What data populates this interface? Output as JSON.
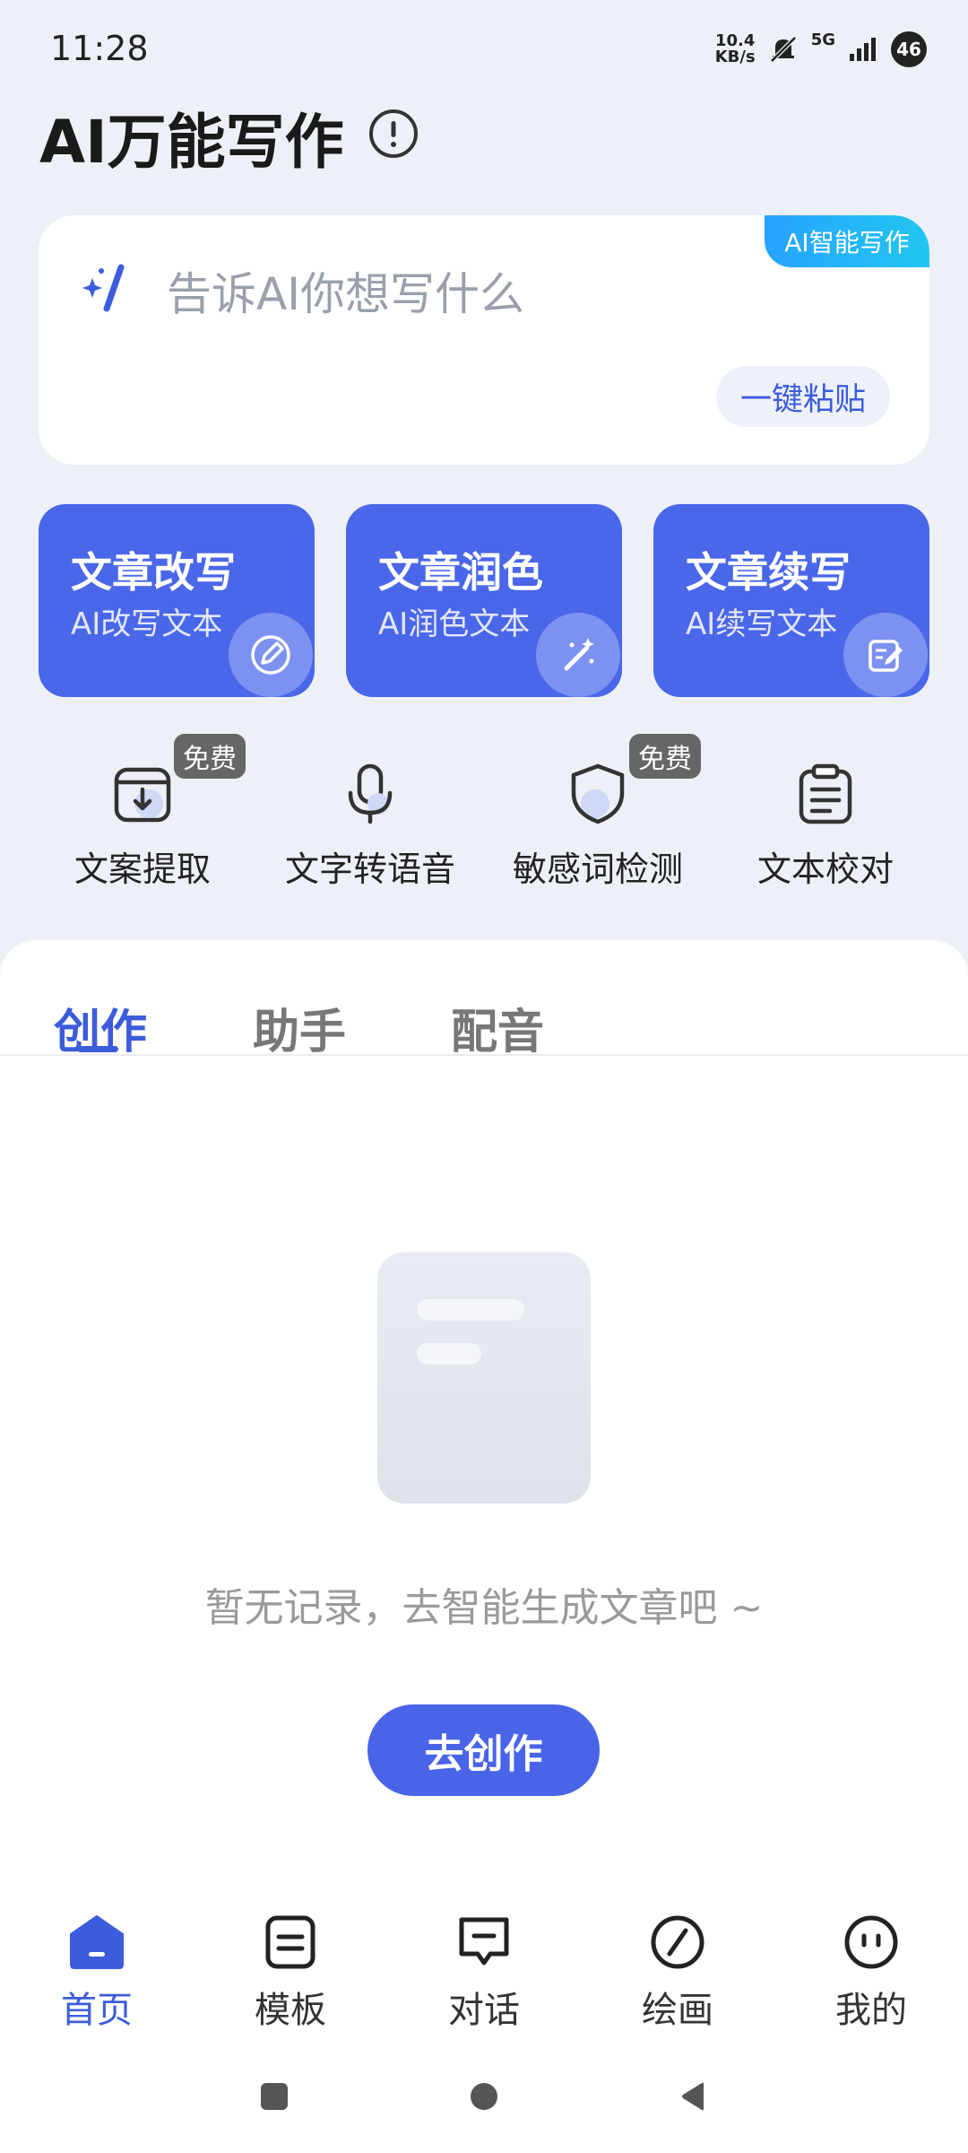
{
  "status_bar": {
    "time": "11:28",
    "net_speed_value": "10.4",
    "net_speed_unit": "KB/s",
    "network": "5G",
    "battery": "46"
  },
  "header": {
    "title": "AI万能写作"
  },
  "input_card": {
    "tag": "AI智能写作",
    "placeholder": "告诉AI你想写什么",
    "paste_label": "一键粘贴"
  },
  "features": [
    {
      "title": "文章改写",
      "subtitle": "AI改写文本",
      "icon": "edit-pen-icon"
    },
    {
      "title": "文章润色",
      "subtitle": "AI润色文本",
      "icon": "magic-wand-icon"
    },
    {
      "title": "文章续写",
      "subtitle": "AI续写文本",
      "icon": "write-note-icon"
    }
  ],
  "tools": [
    {
      "label": "文案提取",
      "badge": "免费",
      "icon": "extract-icon"
    },
    {
      "label": "文字转语音",
      "badge": "",
      "icon": "microphone-icon"
    },
    {
      "label": "敏感词检测",
      "badge": "免费",
      "icon": "shield-icon"
    },
    {
      "label": "文本校对",
      "badge": "",
      "icon": "clipboard-icon"
    }
  ],
  "tabs": [
    {
      "label": "创作",
      "active": true
    },
    {
      "label": "助手",
      "active": false
    },
    {
      "label": "配音",
      "active": false
    }
  ],
  "empty_state": {
    "message": "暂无记录，去智能生成文章吧 ~",
    "button_label": "去创作"
  },
  "bottom_nav": [
    {
      "label": "首页",
      "icon": "home-icon",
      "active": true
    },
    {
      "label": "模板",
      "icon": "template-icon",
      "active": false
    },
    {
      "label": "对话",
      "icon": "chat-icon",
      "active": false
    },
    {
      "label": "绘画",
      "icon": "paint-icon",
      "active": false
    },
    {
      "label": "我的",
      "icon": "profile-icon",
      "active": false
    }
  ],
  "colors": {
    "accent": "#3c5cdc",
    "card": "#4a67ea",
    "background": "#eef0f7"
  }
}
